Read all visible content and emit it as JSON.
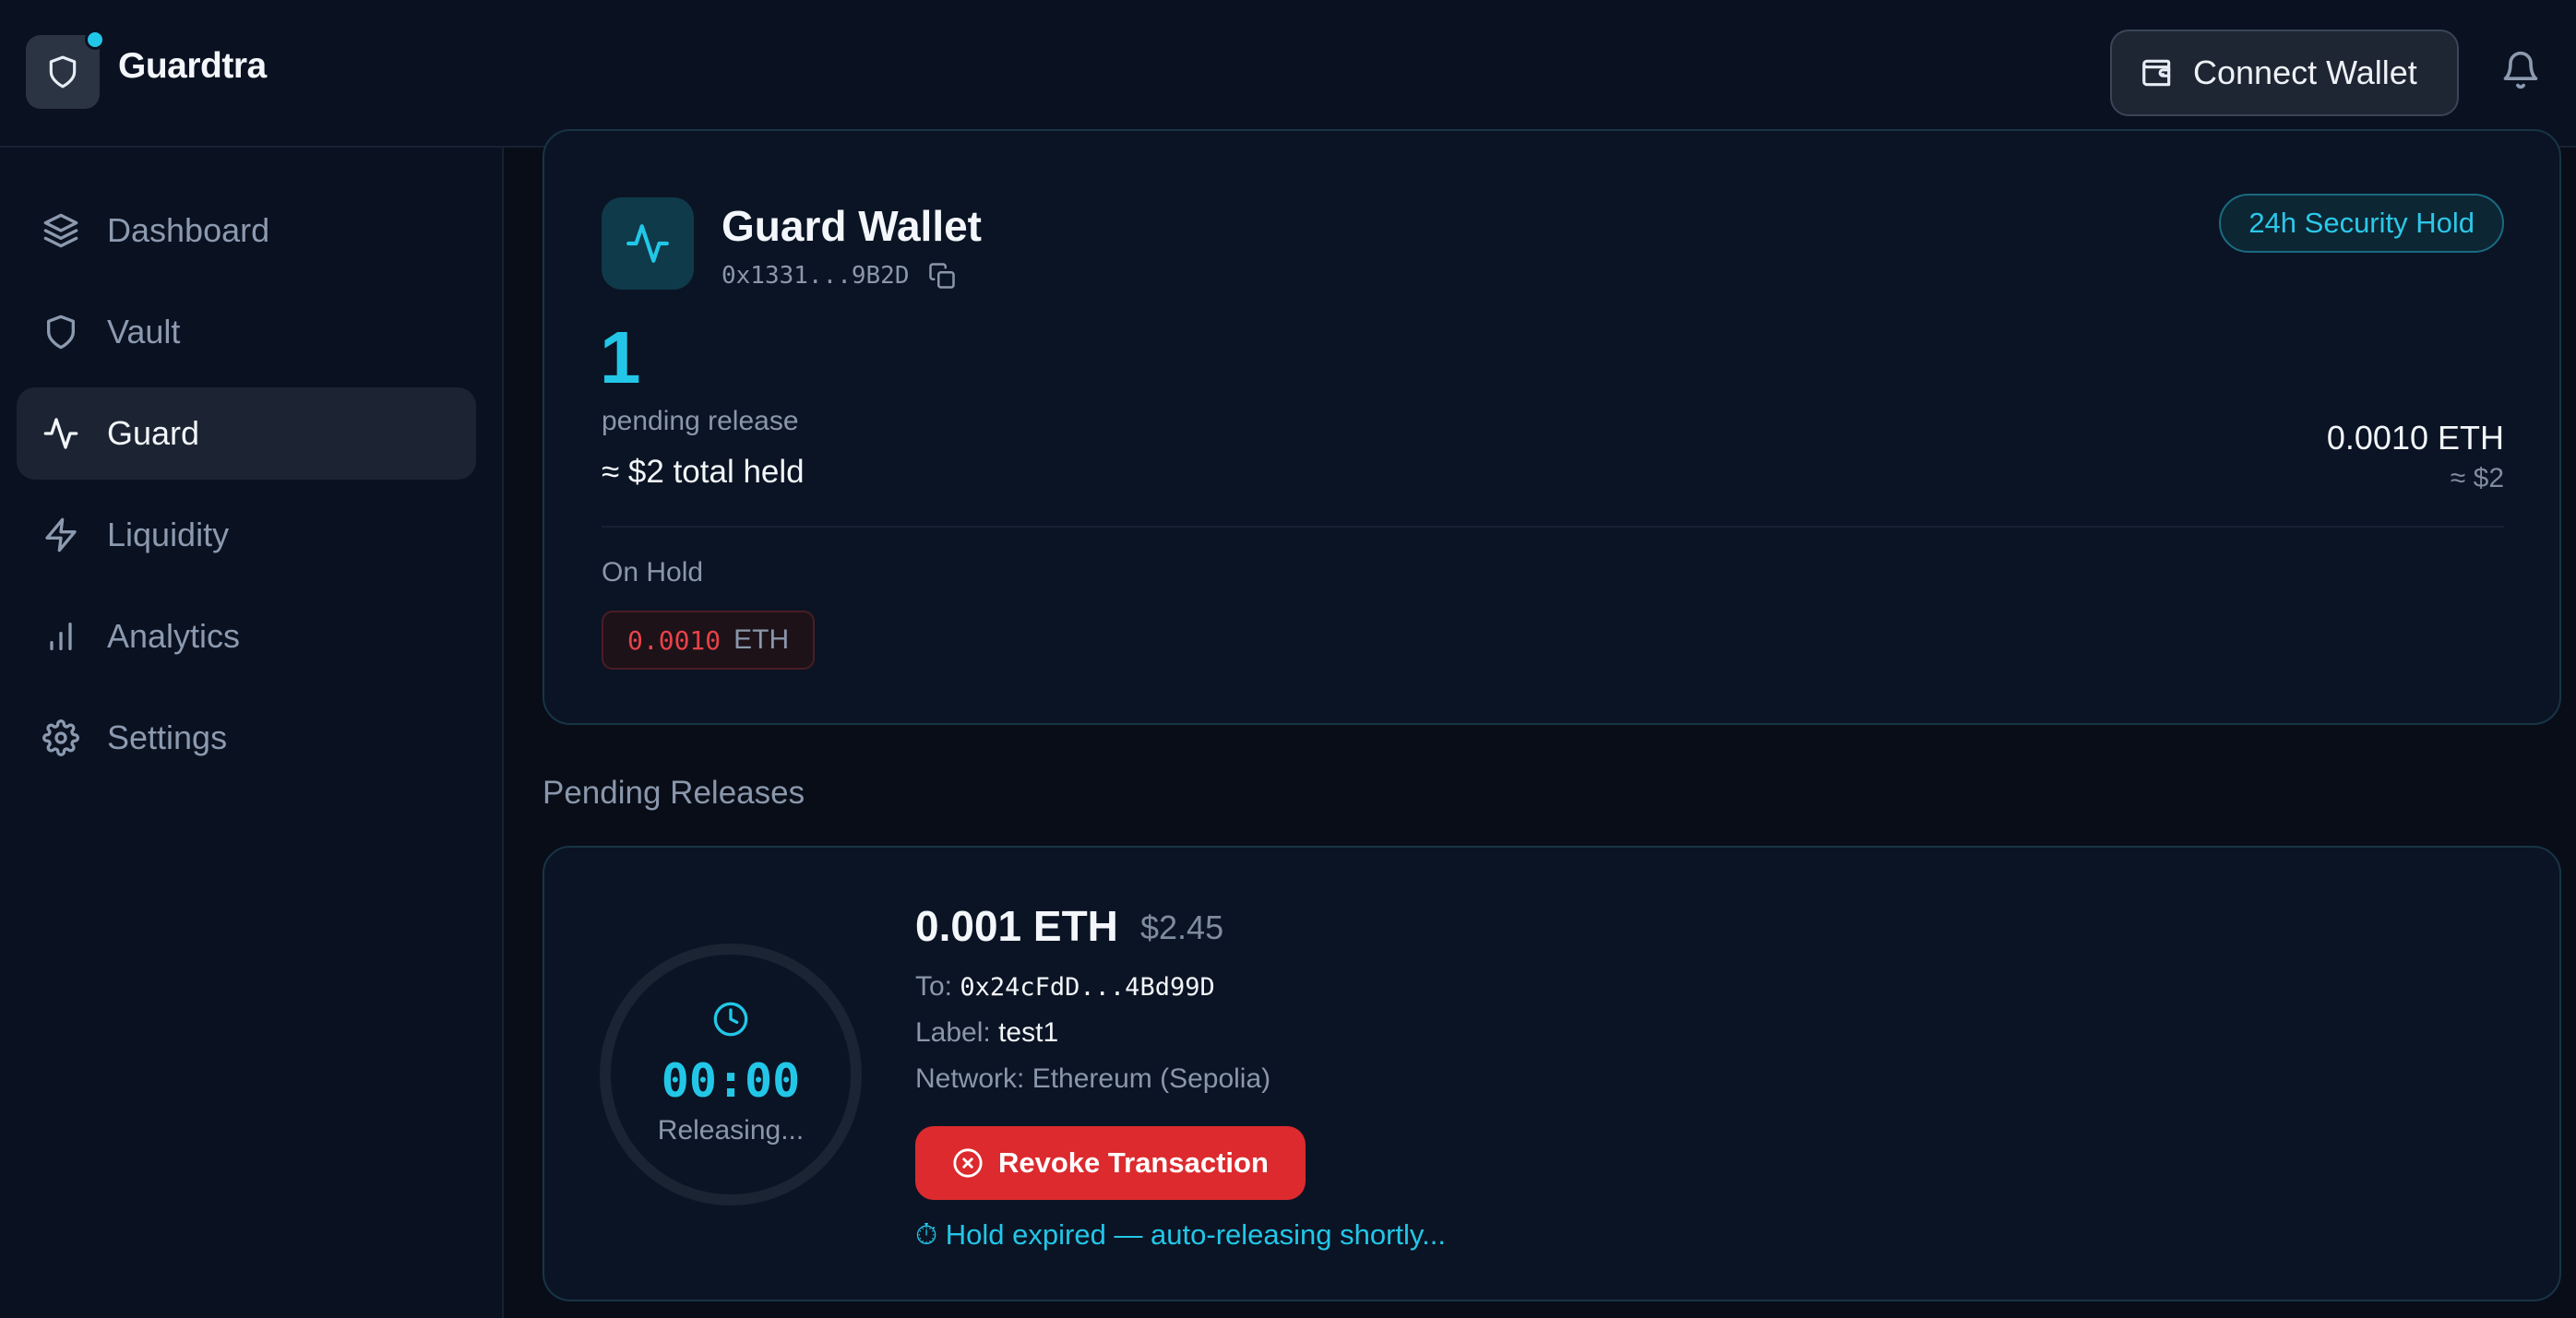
{
  "header": {
    "brand": "Guardtra",
    "connect_wallet": "Connect Wallet"
  },
  "sidebar": {
    "items": [
      {
        "label": "Dashboard",
        "icon": "layers-icon"
      },
      {
        "label": "Vault",
        "icon": "shield-icon"
      },
      {
        "label": "Guard",
        "icon": "activity-icon",
        "active": true
      },
      {
        "label": "Liquidity",
        "icon": "bolt-icon"
      },
      {
        "label": "Analytics",
        "icon": "bar-chart-icon"
      },
      {
        "label": "Settings",
        "icon": "gear-icon"
      }
    ]
  },
  "wallet": {
    "title": "Guard Wallet",
    "address": "0x1331...9B2D",
    "badge": "24h Security Hold",
    "pending_count": "1",
    "pending_label": "pending release",
    "total_held": "≈ $2 total held",
    "eth_amount": "0.0010 ETH",
    "usd_amount": "≈ $2",
    "on_hold_label": "On Hold",
    "hold_amount": "0.0010",
    "hold_unit": "ETH"
  },
  "pending": {
    "section_title": "Pending Releases",
    "timer": "00:00",
    "timer_status": "Releasing...",
    "amount": "0.001 ETH",
    "usd": "$2.45",
    "to_label": "To:",
    "to_value": "0x24cFdD...4Bd99D",
    "label_label": "Label:",
    "label_value": "test1",
    "network": "Network: Ethereum (Sepolia)",
    "revoke_label": "Revoke Transaction",
    "expired_message": "⏱ Hold expired — auto-releasing shortly..."
  },
  "colors": {
    "accent": "#22c7e8",
    "danger": "#dc2a2e",
    "background": "#080d18"
  }
}
